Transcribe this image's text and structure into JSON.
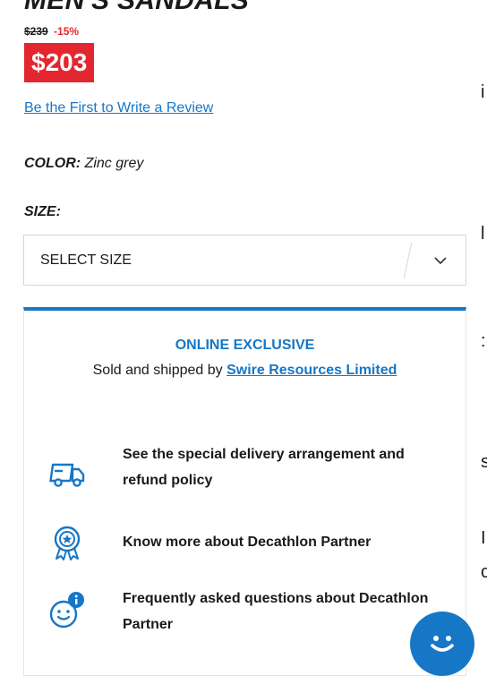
{
  "product": {
    "title": "MEN'S SANDALS",
    "old_price": "$239",
    "discount": "-15%",
    "price": "$203",
    "review_link": "Be the First to Write a Review",
    "color_label": "COLOR:",
    "color_value": "Zinc grey",
    "size_label": "SIZE:",
    "size_select_value": "SELECT SIZE"
  },
  "panel": {
    "exclusive": "ONLINE EXCLUSIVE",
    "sold_by_prefix": "Sold and shipped by",
    "partner": "Swire Resources Limited",
    "items": [
      {
        "icon": "delivery-truck-icon",
        "text": "See the special delivery arrangement and refund policy"
      },
      {
        "icon": "partner-badge-icon",
        "text": "Know more about Decathlon Partner"
      },
      {
        "icon": "faq-smiley-info-icon",
        "text": "Frequently asked questions about Decathlon Partner"
      }
    ]
  },
  "chat": {
    "icon": "chat-smiley-icon"
  },
  "colors": {
    "accent": "#1677c7",
    "price_red": "#e3262f"
  }
}
